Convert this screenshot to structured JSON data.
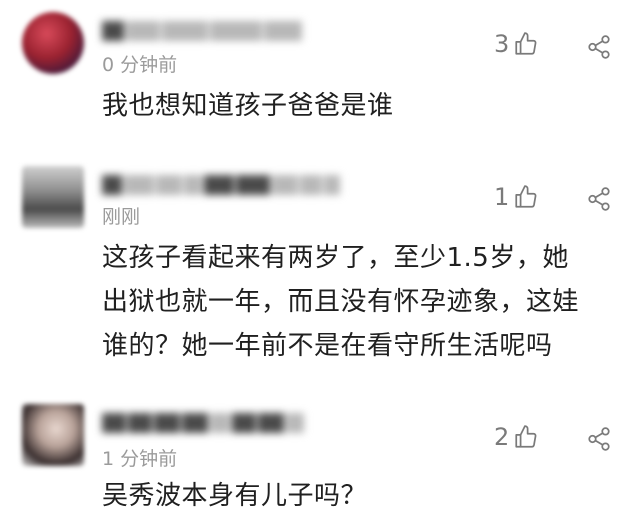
{
  "comments": [
    {
      "time": "0 分钟前",
      "text": "我也想知道孩子爸爸是谁",
      "likes": "3",
      "avatar_icon": "user-avatar-icon"
    },
    {
      "time": "刚刚",
      "text_lines": [
        "这孩子看起来有两岁了，至少1.5岁，她",
        "出狱也就一年，而且没有怀孕迹象，这娃",
        "谁的？她一年前不是在看守所生活呢吗"
      ],
      "likes": "1",
      "avatar_icon": "user-avatar-icon"
    },
    {
      "time": "1 分钟前",
      "text": "吴秀波本身有儿子吗？",
      "likes": "2",
      "avatar_icon": "user-avatar-icon"
    }
  ],
  "icons": {
    "like": "thumbs-up-icon",
    "share": "share-icon"
  },
  "colors": {
    "text": "#202020",
    "meta": "#9b9b9b",
    "icon": "#7a7a7a"
  }
}
